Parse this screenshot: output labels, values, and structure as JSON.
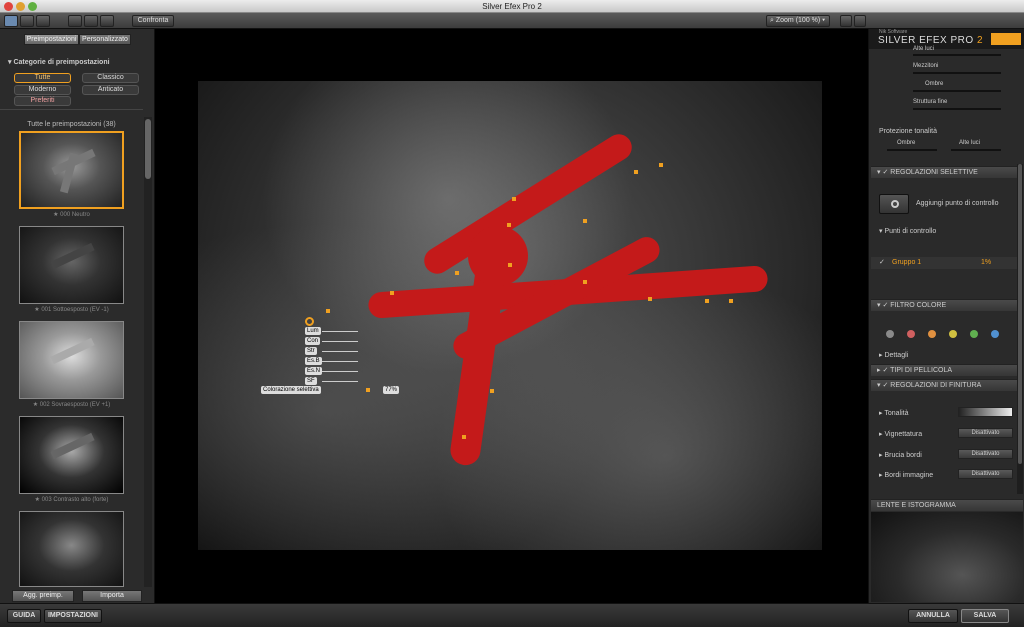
{
  "window": {
    "title": "Silver Efex Pro 2"
  },
  "toolbar": {
    "compare_label": "Confronta",
    "zoom_label": "Zoom (100 %)"
  },
  "left": {
    "tabs": [
      "Preimpostazioni",
      "Personalizzato"
    ],
    "categories_header": "Categorie di preimpostazioni",
    "categories": [
      "Tutte",
      "Classico",
      "Moderno",
      "Anticato",
      "Preferiti"
    ],
    "presets_header": "Tutte le preimpostazioni (38)",
    "presets": [
      "★ 000 Neutro",
      "★ 001 Sottoesposto (EV -1)",
      "★ 002 Sovraesposto (EV +1)",
      "★ 003 Contrasto alto (forte)"
    ],
    "add_preset": "Agg. preimp.",
    "import": "Importa"
  },
  "overlay": {
    "items": [
      "Lum",
      "Con",
      "Str",
      "Es.B",
      "Es.N",
      "SF"
    ],
    "selective_label": "Colorazione selettiva",
    "selective_value": "77%"
  },
  "right": {
    "brand_small": "Nik Software",
    "brand": "SILVER EFEX PRO",
    "brand_version": "2",
    "sliders": [
      "Alte luci",
      "Mezzitoni",
      "Ombre",
      "Struttura fine"
    ],
    "tone_protection": "Protezione tonalità",
    "protect_shadows": "Ombre",
    "protect_highlights": "Alte luci",
    "selective_header": "REGOLAZIONI SELETTIVE",
    "add_cp": "Aggiungi punto di controllo",
    "cp_header": "Punti di controllo",
    "group_label": "Gruppo 1",
    "group_value": "1%",
    "color_filter_header": "FILTRO COLORE",
    "details": "Dettagli",
    "film_header": "TIPI DI PELLICOLA",
    "finish_header": "REGOLAZIONI DI FINITURA",
    "finish": [
      {
        "label": "Tonalità",
        "value": ""
      },
      {
        "label": "Vignettatura",
        "value": "Disattivato"
      },
      {
        "label": "Brucia bordi",
        "value": "Disattivato"
      },
      {
        "label": "Bordi immagine",
        "value": "Disattivato"
      }
    ],
    "loupe_header": "LENTE E ISTOGRAMMA",
    "filter_colors": [
      "#8a8a8a",
      "#d06060",
      "#e09040",
      "#d0c040",
      "#60b050",
      "#5090d0"
    ]
  },
  "bottom": {
    "help": "GUIDA",
    "settings": "IMPOSTAZIONI",
    "cancel": "ANNULLA",
    "save": "SALVA"
  }
}
